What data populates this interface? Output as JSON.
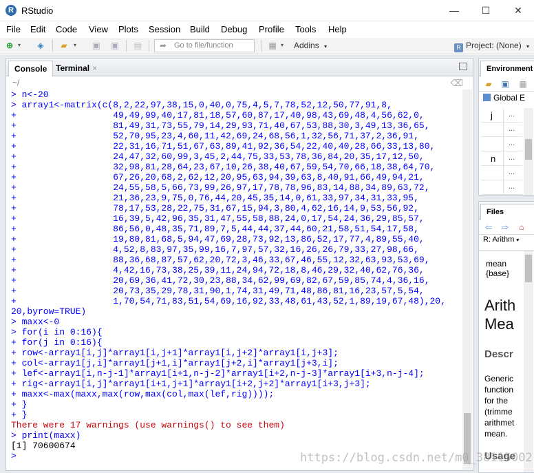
{
  "window": {
    "title": "RStudio",
    "controls": {
      "minimize": "—",
      "maximize": "☐",
      "close": "✕"
    }
  },
  "menu": [
    "File",
    "Edit",
    "Code",
    "View",
    "Plots",
    "Session",
    "Build",
    "Debug",
    "Profile",
    "Tools",
    "Help"
  ],
  "toolbar": {
    "goto_placeholder": "Go to file/function",
    "addins_label": "Addins",
    "project_label": "Project: (None)"
  },
  "console_pane": {
    "tabs": [
      "Console",
      "Terminal"
    ],
    "path": "~/",
    "lines": [
      {
        "kind": "in",
        "text": "> n<-20"
      },
      {
        "kind": "in",
        "text": "> array1<-matrix(c(8,2,22,97,38,15,0,40,0,75,4,5,7,78,52,12,50,77,91,8,"
      },
      {
        "kind": "in",
        "text": "+                  49,49,99,40,17,81,18,57,60,87,17,40,98,43,69,48,4,56,62,0,"
      },
      {
        "kind": "in",
        "text": "+                  81,49,31,73,55,79,14,29,93,71,40,67,53,88,30,3,49,13,36,65,"
      },
      {
        "kind": "in",
        "text": "+                  52,70,95,23,4,60,11,42,69,24,68,56,1,32,56,71,37,2,36,91,"
      },
      {
        "kind": "in",
        "text": "+                  22,31,16,71,51,67,63,89,41,92,36,54,22,40,40,28,66,33,13,80,"
      },
      {
        "kind": "in",
        "text": "+                  24,47,32,60,99,3,45,2,44,75,33,53,78,36,84,20,35,17,12,50,"
      },
      {
        "kind": "in",
        "text": "+                  32,98,81,28,64,23,67,10,26,38,40,67,59,54,70,66,18,38,64,70,"
      },
      {
        "kind": "in",
        "text": "+                  67,26,20,68,2,62,12,20,95,63,94,39,63,8,40,91,66,49,94,21,"
      },
      {
        "kind": "in",
        "text": "+                  24,55,58,5,66,73,99,26,97,17,78,78,96,83,14,88,34,89,63,72,"
      },
      {
        "kind": "in",
        "text": "+                  21,36,23,9,75,0,76,44,20,45,35,14,0,61,33,97,34,31,33,95,"
      },
      {
        "kind": "in",
        "text": "+                  78,17,53,28,22,75,31,67,15,94,3,80,4,62,16,14,9,53,56,92,"
      },
      {
        "kind": "in",
        "text": "+                  16,39,5,42,96,35,31,47,55,58,88,24,0,17,54,24,36,29,85,57,"
      },
      {
        "kind": "in",
        "text": "+                  86,56,0,48,35,71,89,7,5,44,44,37,44,60,21,58,51,54,17,58,"
      },
      {
        "kind": "in",
        "text": "+                  19,80,81,68,5,94,47,69,28,73,92,13,86,52,17,77,4,89,55,40,"
      },
      {
        "kind": "in",
        "text": "+                  4,52,8,83,97,35,99,16,7,97,57,32,16,26,26,79,33,27,98,66,"
      },
      {
        "kind": "in",
        "text": "+                  88,36,68,87,57,62,20,72,3,46,33,67,46,55,12,32,63,93,53,69,"
      },
      {
        "kind": "in",
        "text": "+                  4,42,16,73,38,25,39,11,24,94,72,18,8,46,29,32,40,62,76,36,"
      },
      {
        "kind": "in",
        "text": "+                  20,69,36,41,72,30,23,88,34,62,99,69,82,67,59,85,74,4,36,16,"
      },
      {
        "kind": "in",
        "text": "+                  20,73,35,29,78,31,90,1,74,31,49,71,48,86,81,16,23,57,5,54,"
      },
      {
        "kind": "in",
        "text": "+                  1,70,54,71,83,51,54,69,16,92,33,48,61,43,52,1,89,19,67,48),20,"
      },
      {
        "kind": "in",
        "text": "20,byrow=TRUE)"
      },
      {
        "kind": "in",
        "text": "> maxx<-0"
      },
      {
        "kind": "in",
        "text": "> for(i in 0:16){"
      },
      {
        "kind": "in",
        "text": "+ for(j in 0:16){"
      },
      {
        "kind": "in",
        "text": "+ row<-array1[i,j]*array1[i,j+1]*array1[i,j+2]*array1[i,j+3];"
      },
      {
        "kind": "in",
        "text": "+ col<-array1[j,i]*array1[j+1,i]*array1[j+2,i]*array1[j+3,i];"
      },
      {
        "kind": "in",
        "text": "+ lef<-array1[i,n-j-1]*array1[i+1,n-j-2]*array1[i+2,n-j-3]*array1[i+3,n-j-4];"
      },
      {
        "kind": "in",
        "text": "+ rig<-array1[i,j]*array1[i+1,j+1]*array1[i+2,j+2]*array1[i+3,j+3];"
      },
      {
        "kind": "in",
        "text": "+ maxx<-max(maxx,max(row,max(col,max(lef,rig))));"
      },
      {
        "kind": "in",
        "text": "+ }"
      },
      {
        "kind": "in",
        "text": "+ }"
      },
      {
        "kind": "warn",
        "text": "There were 17 warnings (use warnings() to see them)"
      },
      {
        "kind": "in",
        "text": "> print(maxx)"
      },
      {
        "kind": "out",
        "text": "[1] 70600674"
      },
      {
        "kind": "in",
        "text": ">"
      }
    ]
  },
  "environment_pane": {
    "tab": "Environment",
    "scope": "Global E",
    "vars": [
      {
        "name": "j",
        "val": "..."
      },
      {
        "name": "",
        "val": "..."
      },
      {
        "name": "",
        "val": "..."
      },
      {
        "name": "n",
        "val": "..."
      },
      {
        "name": "",
        "val": "..."
      },
      {
        "name": "",
        "val": "..."
      }
    ]
  },
  "files_pane": {
    "tab": "Files",
    "help_topic": "R: Arithm",
    "meta_line1": "mean",
    "meta_line2": "{base}",
    "doc_title_1": "Arith",
    "doc_title_2": "Mea",
    "section": "Descr",
    "body_lines": [
      "Generic",
      "function",
      "for the",
      "(trimme",
      "arithmet",
      "mean."
    ],
    "section2": "Usage"
  },
  "watermark": "https://blog.csdn.net/m0_38115002"
}
